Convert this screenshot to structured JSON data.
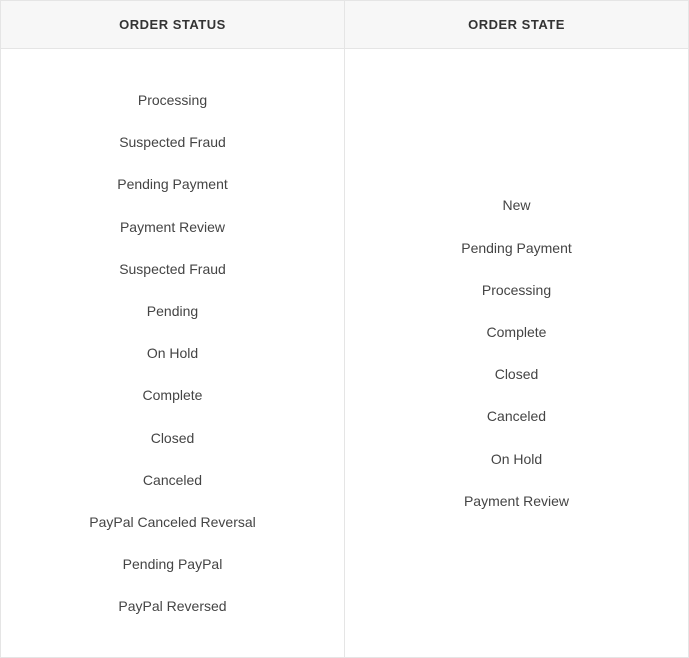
{
  "headers": {
    "status": "ORDER STATUS",
    "state": "ORDER STATE"
  },
  "order_status": [
    "Processing",
    "Suspected Fraud",
    "Pending Payment",
    "Payment Review",
    "Suspected Fraud",
    "Pending",
    "On Hold",
    "Complete",
    "Closed",
    "Canceled",
    "PayPal Canceled Reversal",
    "Pending PayPal",
    "PayPal Reversed"
  ],
  "order_state": [
    "New",
    "Pending Payment",
    "Processing",
    "Complete",
    "Closed",
    "Canceled",
    "On Hold",
    "Payment Review"
  ]
}
